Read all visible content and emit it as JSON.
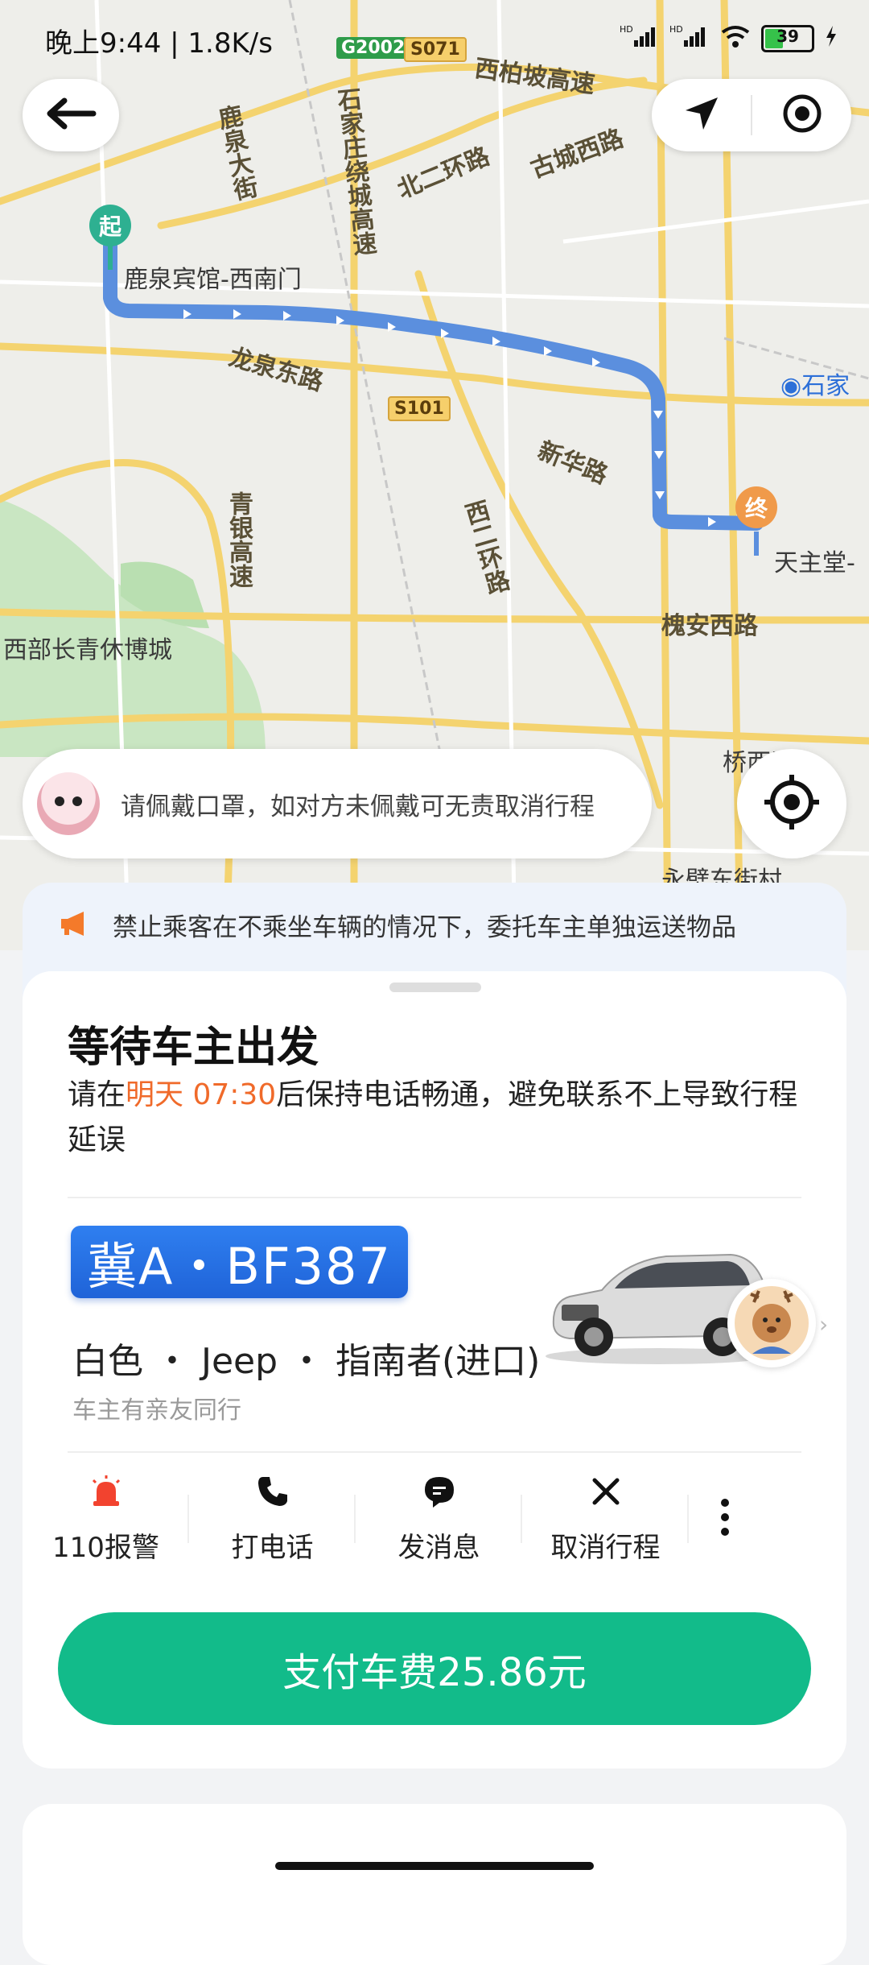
{
  "status_bar": {
    "time": "晚上9:44 | 1.8K/s",
    "battery": "39",
    "signal_labels": [
      "HD",
      "HD"
    ]
  },
  "map": {
    "labels": {
      "highway_g2002": "G2002",
      "road_s071": "S071",
      "road_s101": "S101",
      "xibaipo": "西柏坡高速",
      "shijiazhuang_ring": "石家庄绕城高速",
      "beierhuan": "北二环路",
      "guchengxilu": "古城西路",
      "lujiadajie": "鹿泉大街",
      "longquandonglu": "龙泉东路",
      "xinhualu": "新华路",
      "qingyin": "青银高速",
      "xierhuan": "西二环路",
      "huaiandonglu": "槐安西路",
      "xibu": "西部长青休博城",
      "tianzhutang": "天主堂-",
      "shijia_station": "石家",
      "qiaoxi": "桥西区",
      "yongbi": "永壁东街村"
    },
    "start_pin": "起",
    "end_pin": "终",
    "start_name": "鹿泉宾馆-西南门"
  },
  "mask_tip": "请佩戴口罩，如对方未佩戴可无责取消行程",
  "notice": "禁止乘客在不乘坐车辆的情况下，委托车主单独运送物品",
  "trip": {
    "title": "等待车主出发",
    "desc_prefix": "请在",
    "desc_time": "明天 07:30",
    "desc_suffix": "后保持电话畅通，避免联系不上导致行程延误"
  },
  "car": {
    "plate": "冀A・BF387",
    "info": "白色 ・ Jeep ・ 指南者(进口)",
    "sub": "车主有亲友同行"
  },
  "actions": [
    {
      "label": "110报警"
    },
    {
      "label": "打电话"
    },
    {
      "label": "发消息"
    },
    {
      "label": "取消行程"
    }
  ],
  "pay_button": "支付车费25.86元",
  "colors": {
    "accent": "#12bb8a",
    "highlight": "#f06a2a",
    "route": "#5b8fde",
    "plate": "#2f7ff0"
  }
}
